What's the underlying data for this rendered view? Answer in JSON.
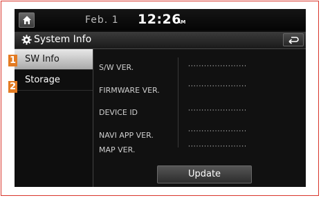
{
  "status": {
    "date": "Feb.  1",
    "time": "12:26",
    "ampm": "AM"
  },
  "header": {
    "title": "System Info"
  },
  "sidebar": {
    "items": [
      {
        "label": "SW Info",
        "marker": "1"
      },
      {
        "label": "Storage",
        "marker": "2"
      }
    ]
  },
  "info": {
    "rows": [
      {
        "label": "S/W VER.",
        "value": "······················"
      },
      {
        "label": "FIRMWARE VER.",
        "value": "······················"
      },
      {
        "label": "DEVICE ID",
        "value": "······················"
      },
      {
        "label": "NAVI APP VER.",
        "value": "······················"
      },
      {
        "label": "MAP VER.",
        "value": "······················"
      }
    ]
  },
  "actions": {
    "update_label": "Update"
  },
  "colors": {
    "marker": "#e37b22",
    "frame": "#d9352b"
  },
  "icons": {
    "home": "home-icon",
    "settings": "gear-icon",
    "back": "back-icon"
  }
}
